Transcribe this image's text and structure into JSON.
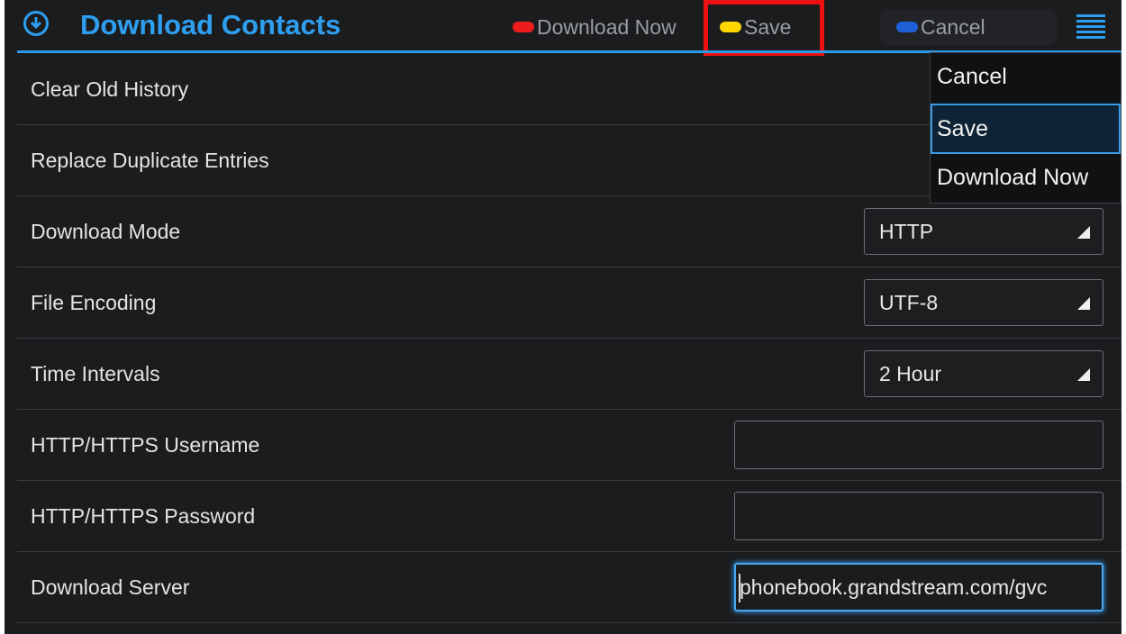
{
  "header": {
    "title": "Download Contacts",
    "actions": [
      {
        "label": "Download Now",
        "color": "#ee1c1c"
      },
      {
        "label": "Save",
        "color": "#ffd700"
      },
      {
        "label": "Cancel",
        "color": "#1e5fd8"
      }
    ],
    "accent_color": "#2e9ff0",
    "app_icon": "download-circle-icon",
    "overflow_icon": "menu-icon"
  },
  "settings": [
    {
      "label": "Clear Old History",
      "control": "toggle"
    },
    {
      "label": "Replace Duplicate Entries",
      "control": "toggle"
    },
    {
      "label": "Download Mode",
      "control": "spinner",
      "value": "HTTP"
    },
    {
      "label": "File Encoding",
      "control": "spinner",
      "value": "UTF-8"
    },
    {
      "label": "Time Intervals",
      "control": "spinner",
      "value": "2 Hour"
    },
    {
      "label": "HTTP/HTTPS Username",
      "control": "text",
      "value": ""
    },
    {
      "label": "HTTP/HTTPS Password",
      "control": "text",
      "value": ""
    },
    {
      "label": "Download Server",
      "control": "text",
      "value": "phonebook.grandstream.com/gvc"
    }
  ],
  "overflow_menu": {
    "items": [
      "Cancel",
      "Save",
      "Download Now"
    ],
    "selected": "Save"
  }
}
